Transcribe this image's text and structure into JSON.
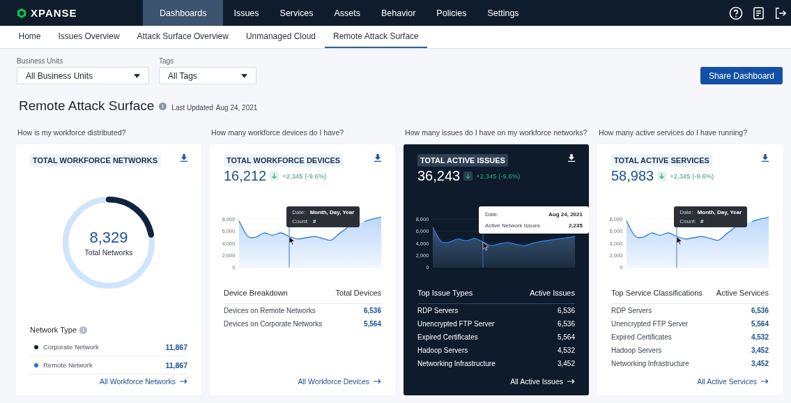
{
  "brand": {
    "name": "XPANSE"
  },
  "main_nav": [
    {
      "label": "Dashboards",
      "selected": true
    },
    {
      "label": "Issues",
      "selected": false
    },
    {
      "label": "Services",
      "selected": false
    },
    {
      "label": "Assets",
      "selected": false
    },
    {
      "label": "Behavior",
      "selected": false
    },
    {
      "label": "Policies",
      "selected": false
    },
    {
      "label": "Settings",
      "selected": false
    }
  ],
  "sub_nav": [
    {
      "label": "Home",
      "selected": false
    },
    {
      "label": "Issues Overview",
      "selected": false
    },
    {
      "label": "Attack Surface Overview",
      "selected": false
    },
    {
      "label": "Unmanaged Cloud",
      "selected": false
    },
    {
      "label": "Remote Attack Surface",
      "selected": true
    }
  ],
  "filters": [
    {
      "label": "Business Units",
      "value": "All Business Units"
    },
    {
      "label": "Tags",
      "value": "All Tags"
    }
  ],
  "share_button": "Share Dashboard",
  "page": {
    "title": "Remote Attack Surface",
    "updated_label": "Last Updated",
    "updated_date": "Aug 24, 2021"
  },
  "sections": [
    {
      "question": "How is my workforce distributed?",
      "card": {
        "kind": "donut",
        "highlighted": false,
        "title": "TOTAL WORKFORCE NETWORKS",
        "level": 0.22,
        "value": "8,329",
        "caption": "Total Networks",
        "legend_title": "Network Type",
        "legend": [
          {
            "label": "Corporate Network",
            "value": "11,867",
            "color": "#0d2340"
          },
          {
            "label": "Remote Network",
            "value": "11,867",
            "color": "#1f6fe8"
          }
        ],
        "link": "All Workforce Networks"
      }
    },
    {
      "question": "How many workforce devices do I have?",
      "card": {
        "kind": "trend",
        "highlighted": false,
        "title": "TOTAL WORKFORCE DEVICES",
        "value": "16,212",
        "change": "+2,345 (-9.6%)",
        "chart_data": {
          "type": "area",
          "grid": true,
          "ylim": [
            0,
            8400
          ],
          "yticks": [
            {
              "value": 0,
              "label": "0"
            },
            {
              "value": 2000,
              "label": "2,000"
            },
            {
              "value": 4000,
              "label": "4,000"
            },
            {
              "value": 6000,
              "label": "6,000"
            },
            {
              "value": 8000,
              "label": "8,000"
            }
          ],
          "values": [
            7700,
            5200,
            5000,
            5700,
            5300,
            5700,
            5100,
            4700,
            4900,
            5100,
            4800,
            4500,
            5600,
            6600,
            null,
            7600,
            8000,
            8300
          ]
        },
        "tooltip": [
          {
            "label": "Date:",
            "value": "Month, Day, Year"
          },
          {
            "label": "Count:",
            "value": "#"
          }
        ],
        "table": {
          "columns": [
            "Device Breakdown",
            "Total Devices"
          ],
          "rows": [
            {
              "name": "Devices on Remote Networks",
              "value": "6,536"
            },
            {
              "name": "Devices on Corporate Networks",
              "value": "5,564"
            }
          ]
        },
        "link": "All Workforce Devices"
      }
    },
    {
      "question": "How many issues do I have on my workforce networks?",
      "card": {
        "kind": "trend",
        "highlighted": true,
        "title": "TOTAL ACTIVE ISSUES",
        "value": "36,243",
        "change": "+2,345 (-9.6%)",
        "chart_data": {
          "type": "area",
          "grid": true,
          "ylim": [
            0,
            8400
          ],
          "yticks": [
            {
              "value": 0,
              "label": "0"
            },
            {
              "value": 2000,
              "label": "2,000"
            },
            {
              "value": 4000,
              "label": "4,000"
            },
            {
              "value": 6000,
              "label": "6,000"
            },
            {
              "value": 8000,
              "label": "8,000"
            }
          ],
          "values": [
            6600,
            4300,
            4200,
            4700,
            4400,
            4800,
            4200,
            3600,
            3900,
            4100,
            3800,
            3600,
            4000,
            4300,
            4500,
            4700,
            4900,
            5100
          ]
        },
        "tooltip": [
          {
            "label": "Date:",
            "value": "Aug 24, 2021"
          },
          {
            "label": "Active Network Issues",
            "value": "2,235"
          }
        ],
        "table": {
          "columns": [
            "Top Issue Types",
            "Active Issues"
          ],
          "rows": [
            {
              "name": "RDP Servers",
              "value": "6,536"
            },
            {
              "name": "Unencrypted FTP Server",
              "value": "6,536"
            },
            {
              "name": "Expired Certificates",
              "value": "5,564"
            },
            {
              "name": "Hadoop Servers",
              "value": "4,532"
            },
            {
              "name": "Networking Infrastructure",
              "value": "3,452"
            }
          ]
        },
        "link": "All Active Issues"
      }
    },
    {
      "question": "How many active services do I have running?",
      "card": {
        "kind": "trend",
        "highlighted": false,
        "title": "TOTAL ACTIVE SERVICES",
        "value": "58,983",
        "change": "+2,345 (-9.6%)",
        "chart_data": {
          "type": "area",
          "grid": true,
          "ylim": [
            0,
            8400
          ],
          "yticks": [
            {
              "value": 0,
              "label": "0"
            },
            {
              "value": 2000,
              "label": "2,000"
            },
            {
              "value": 4000,
              "label": "4,000"
            },
            {
              "value": 6000,
              "label": "6,000"
            },
            {
              "value": 8000,
              "label": "8,000"
            }
          ],
          "values": [
            7700,
            5200,
            5000,
            5700,
            5300,
            5700,
            5100,
            4700,
            4900,
            5100,
            4800,
            4500,
            5600,
            6600,
            null,
            7600,
            8000,
            8300
          ]
        },
        "tooltip": [
          {
            "label": "Date:",
            "value": "Month, Day, Year"
          },
          {
            "label": "Count:",
            "value": "#"
          }
        ],
        "table": {
          "columns": [
            "Top Service Classifications",
            "Active Services"
          ],
          "rows": [
            {
              "name": "RDP Servers",
              "value": "6,536"
            },
            {
              "name": "Unencrypted FTP Server",
              "value": "5,564"
            },
            {
              "name": "Expired Certificates",
              "value": "4,532"
            },
            {
              "name": "Hadoop Servers",
              "value": "3,452"
            },
            {
              "name": "Networking Infrastructure",
              "value": "3,452"
            }
          ]
        },
        "link": "All Active Services"
      }
    }
  ]
}
